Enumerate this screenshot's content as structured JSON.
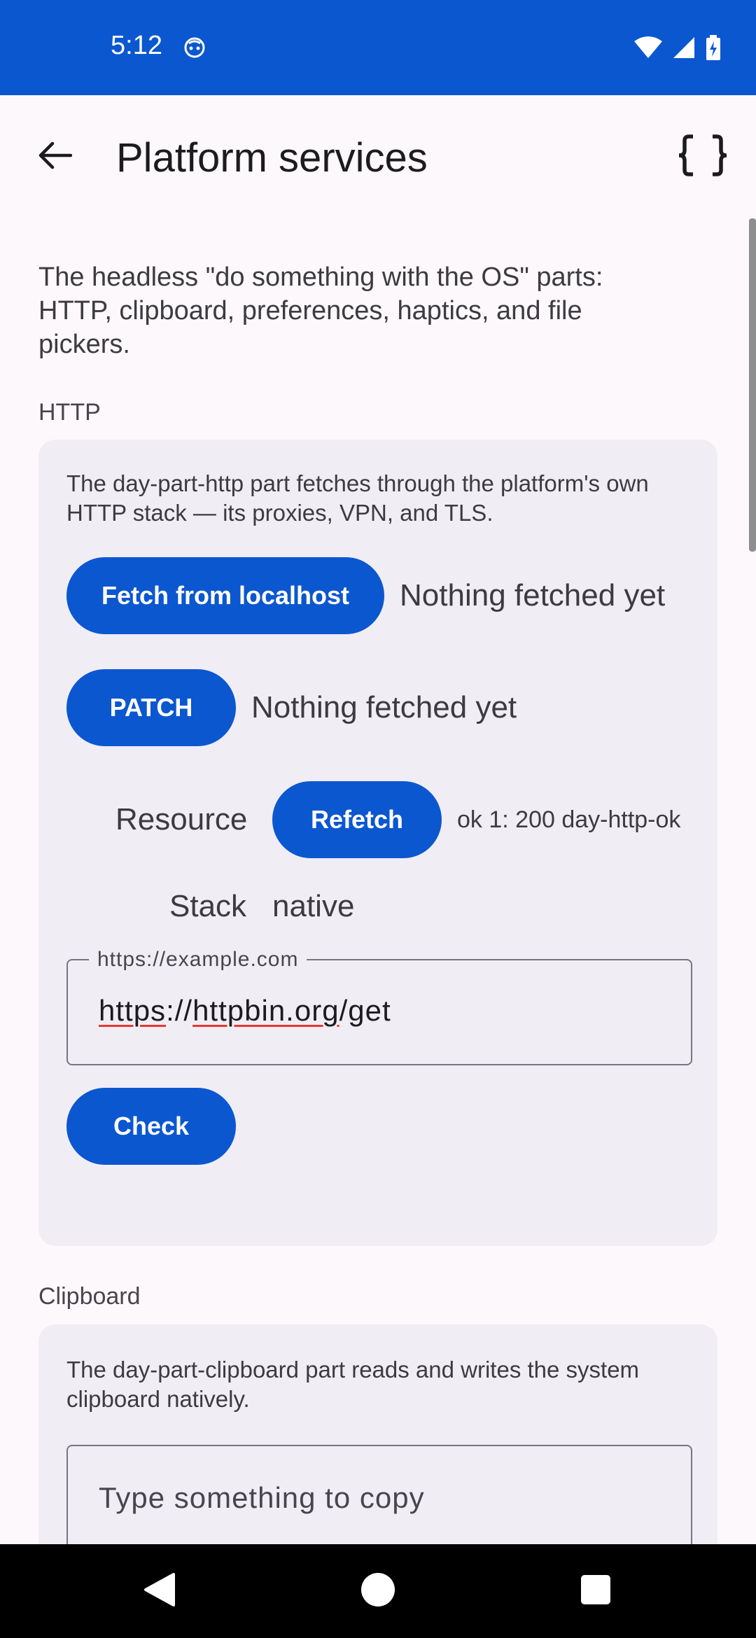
{
  "status_bar": {
    "time": "5:12"
  },
  "app_bar": {
    "title": "Platform services"
  },
  "intro": "The headless \"do something with the OS\" parts: HTTP, clipboard, preferences, haptics, and file pickers.",
  "http": {
    "section_label": "HTTP",
    "description": "The day-part-http part fetches through the platform's own HTTP stack — its proxies, VPN, and TLS.",
    "fetch_button": "Fetch from localhost",
    "fetch_status": "Nothing fetched yet",
    "patch_button": "PATCH",
    "patch_status": "Nothing fetched yet",
    "resource_label": "Resource",
    "refetch_button": "Refetch",
    "refetch_status": "ok 1: 200 day-http-ok",
    "stack_label": "Stack",
    "stack_value": "native",
    "url_field": {
      "label": "https://example.com",
      "value_parts": [
        "https",
        "://",
        "httpbin.org",
        "/get"
      ]
    },
    "check_button": "Check"
  },
  "clipboard": {
    "section_label": "Clipboard",
    "description": "The day-part-clipboard part reads and writes the system clipboard natively.",
    "input_placeholder": "Type something to copy"
  },
  "colors": {
    "accent": "#0b57d0",
    "card": "#f1edf4",
    "background": "#fdf8fc"
  },
  "icons": [
    "face-icon",
    "wifi-icon",
    "signal-icon",
    "battery-charging-icon",
    "back-arrow-icon",
    "braces-icon",
    "nav-back-icon",
    "nav-home-icon",
    "nav-recents-icon"
  ]
}
